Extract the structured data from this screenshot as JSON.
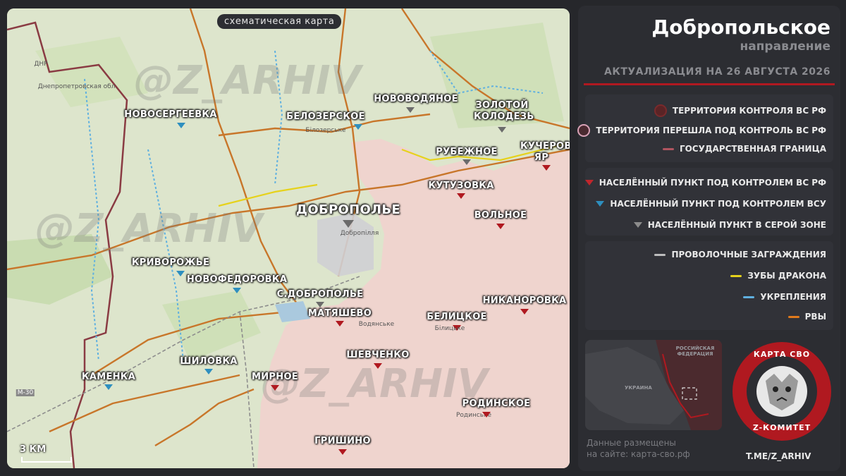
{
  "map": {
    "title": "схематическая карта",
    "scale_label": "3 КМ",
    "watermark": "@Z_ARHIV",
    "places": [
      {
        "name": "НОВОСЕРГЕЕВКА",
        "status": "ua"
      },
      {
        "name": "БЕЛОЗЕРСКОЕ",
        "status": "ua",
        "sub": "Білозерське"
      },
      {
        "name": "НОВОВОДЯНОЕ",
        "status": "gray"
      },
      {
        "name": "ЗОЛОТОЙ КОЛОДЕЗЬ",
        "status": "gray"
      },
      {
        "name": "РУБЕЖНОЕ",
        "status": "gray"
      },
      {
        "name": "КУЧЕРОВ ЯР",
        "status": "ru"
      },
      {
        "name": "КУТУЗОВКА",
        "status": "ru"
      },
      {
        "name": "ДОБРОПОЛЬЕ",
        "status": "gray",
        "sub": "Добропілля"
      },
      {
        "name": "ВОЛЬНОЕ",
        "status": "ru"
      },
      {
        "name": "КРИВОРОЖЬЕ",
        "status": "ua"
      },
      {
        "name": "НОВОФЕДОРОВКА",
        "status": "ua"
      },
      {
        "name": "С.ДОБРОПОЛЬЕ",
        "status": "gray"
      },
      {
        "name": "МАТЯШЕВО",
        "status": "ru",
        "sub": "Водянське"
      },
      {
        "name": "НИКАНОРОВКА",
        "status": "ru"
      },
      {
        "name": "БЕЛИЦКОЕ",
        "status": "ru",
        "sub": "Білицьке"
      },
      {
        "name": "ШЕВЧЕНКО",
        "status": "ru"
      },
      {
        "name": "КАМЕНКА",
        "status": "ua"
      },
      {
        "name": "ШИЛОВКА",
        "status": "ua"
      },
      {
        "name": "МИРНОЕ",
        "status": "ru"
      },
      {
        "name": "РОДИНСКОЕ",
        "status": "ru",
        "sub": "Родинське"
      },
      {
        "name": "ГРИШИНО",
        "status": "ru"
      }
    ],
    "small_labels": [
      "ДНР",
      "Днепропетровская обл.",
      "М-30"
    ]
  },
  "panel": {
    "title": "Добропольское",
    "subtitle": "направление",
    "update": "АКТУАЛИЗАЦИЯ НА 26 АВГУСТА 2026",
    "legend_territory": [
      {
        "label": "ТЕРРИТОРИЯ КОНТРОЛЯ ВС РФ",
        "symbol": "circle-dark-red"
      },
      {
        "label": "ТЕРРИТОРИЯ ПЕРЕШЛА ПОД КОНТРОЛЬ ВС РФ",
        "symbol": "circle-pink"
      },
      {
        "label": "ГОСУДАРСТВЕННАЯ ГРАНИЦА",
        "symbol": "line-red"
      }
    ],
    "legend_settlements": [
      {
        "label": "НАСЕЛЁННЫЙ ПУНКТ ПОД КОНТРОЛЕМ ВС РФ",
        "color": "#c0262c"
      },
      {
        "label": "НАСЕЛЁННЫЙ ПУНКТ ПОД КОНТРОЛЕМ ВСУ",
        "color": "#2e8fbf"
      },
      {
        "label": "НАСЕЛЁННЫЙ ПУНКТ В СЕРОЙ ЗОНЕ",
        "color": "#8c8c8c"
      }
    ],
    "legend_defense": [
      {
        "label": "ПРОВОЛОЧНЫЕ ЗАГРАЖДЕНИЯ",
        "color": "#bdbdbd"
      },
      {
        "label": "ЗУБЫ ДРАКОНА",
        "color": "#e6d21c"
      },
      {
        "label": "УКРЕПЛЕНИЯ",
        "color": "#5fb0e0"
      },
      {
        "label": "РВЫ",
        "color": "#e07a1c"
      }
    ],
    "minimap_labels": {
      "russia": "РОССИЙСКАЯ ФЕДЕРАЦИЯ",
      "ukraine": "УКРАИНА"
    },
    "site_line1": "Данные размещены",
    "site_line2": "на сайте: карта-сво.рф",
    "logo_top": "КАРТА СВО",
    "logo_bottom": "Z-КОМИТЕТ",
    "tme": "T.ME/Z_ARHIV"
  },
  "colors": {
    "accent": "#b01920",
    "ru_zone": "#efd4cf",
    "ua_marker": "#2e8fbf",
    "gray_marker": "#6b6b6b"
  }
}
